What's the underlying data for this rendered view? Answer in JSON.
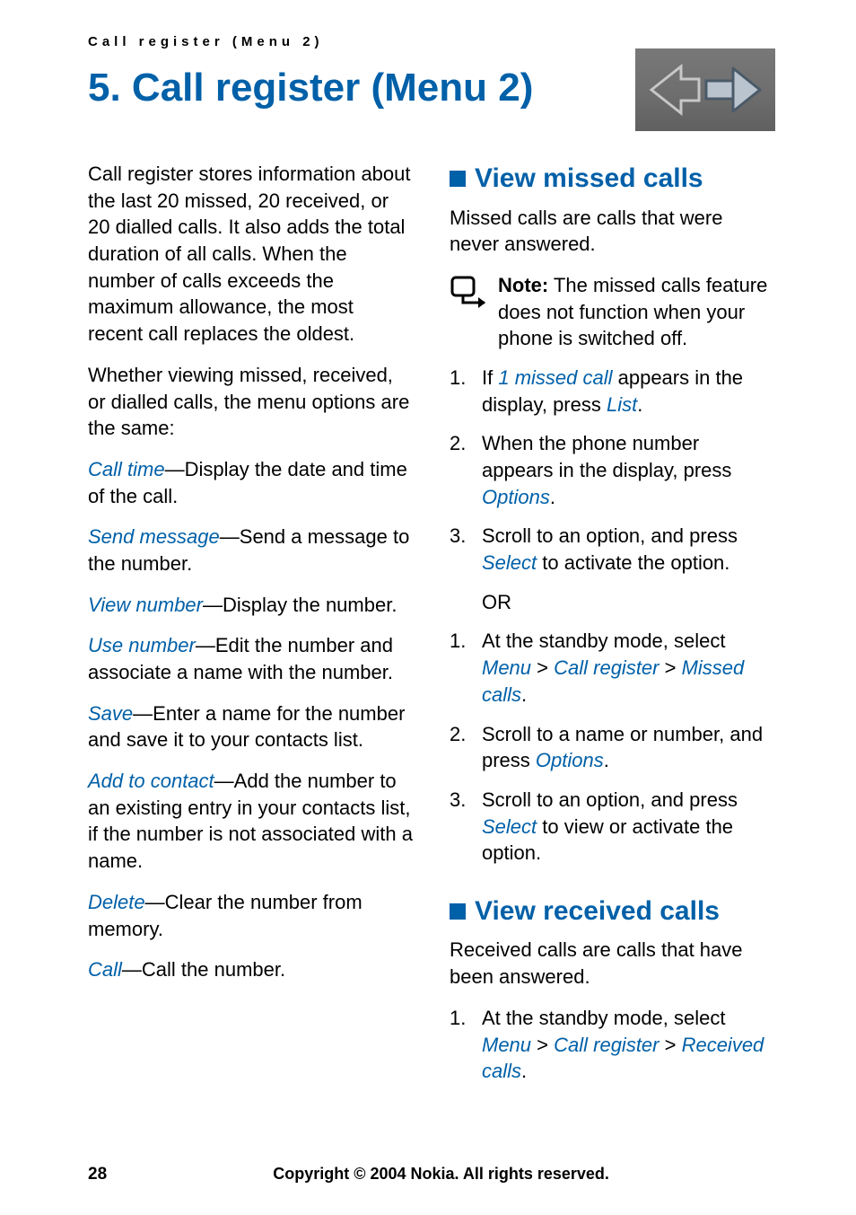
{
  "runningHead": "Call register (Menu 2)",
  "chapter": {
    "title": "5.   Call register (Menu 2)"
  },
  "left": {
    "intro": "Call register stores information about the last 20 missed, 20 received, or 20 dialled calls. It also adds the total duration of all calls. When the number of calls exceeds the maximum allowance, the most recent call replaces the oldest.",
    "intro2": "Whether viewing missed, received, or dialled calls, the menu options are the same:",
    "defs": [
      {
        "term": "Call time",
        "desc": "—Display the date and time of the call."
      },
      {
        "term": "Send message",
        "desc": "—Send a message to the number."
      },
      {
        "term": "View number",
        "desc": "—Display the number."
      },
      {
        "term": "Use number",
        "desc": "—Edit the number and associate a name with the number."
      },
      {
        "term": "Save",
        "desc": "—Enter a name for the number and save it to your contacts list."
      },
      {
        "term": "Add to contact",
        "desc": "—Add the number to an existing entry in your contacts list, if the number is not associated with a name."
      },
      {
        "term": "Delete",
        "desc": "—Clear the number from memory."
      },
      {
        "term": "Call",
        "desc": "—Call the number."
      }
    ]
  },
  "right": {
    "missed": {
      "heading": "View missed calls",
      "intro": "Missed calls are calls that were never answered.",
      "noteLabel": "Note:",
      "noteBody": " The missed calls feature does not function when your phone is switched off.",
      "steps": [
        {
          "n": "1.",
          "pre": "If ",
          "t1": "1 missed call",
          "mid": " appears in the display, press ",
          "t2": "List",
          "post": "."
        },
        {
          "n": "2.",
          "pre": "When the phone number appears in the display, press ",
          "t1": "Options",
          "mid": "",
          "t2": "",
          "post": "."
        },
        {
          "n": "3.",
          "pre": "Scroll to an option, and press ",
          "t1": "Select",
          "mid": " to activate the option.",
          "t2": "",
          "post": ""
        }
      ],
      "or": "OR",
      "stepsAlt": [
        {
          "n": "1.",
          "pre": "At the standby mode, select ",
          "t1": "Menu",
          "s1": " > ",
          "t2": "Call register",
          "s2": " > ",
          "t3": "Missed calls",
          "post": "."
        },
        {
          "n": "2.",
          "pre": "Scroll to a name or number, and press ",
          "t1": "Options",
          "s1": "",
          "t2": "",
          "s2": "",
          "t3": "",
          "post": "."
        },
        {
          "n": "3.",
          "pre": "Scroll to an option, and press ",
          "t1": "Select",
          "s1": " to view or activate the option.",
          "t2": "",
          "s2": "",
          "t3": "",
          "post": ""
        }
      ]
    },
    "received": {
      "heading": "View received calls",
      "intro": "Received calls are calls that have been answered.",
      "steps": [
        {
          "n": "1.",
          "pre": "At the standby mode, select ",
          "t1": "Menu",
          "s1": " > ",
          "t2": "Call register",
          "s2": " > ",
          "t3": "Received calls",
          "post": "."
        }
      ]
    }
  },
  "footer": {
    "page": "28",
    "copyright": "Copyright © 2004 Nokia. All rights reserved."
  }
}
